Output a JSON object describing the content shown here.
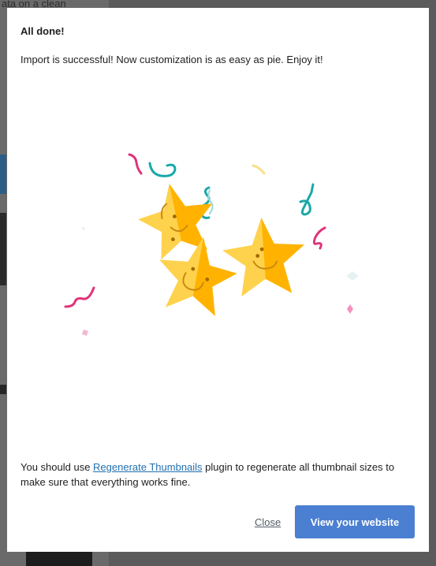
{
  "background": {
    "partial_text": "ata on a clean"
  },
  "dialog": {
    "title": "All done!",
    "message": "Import is successful! Now customization is as easy as pie. Enjoy it!",
    "note_prefix": "You should use ",
    "note_link": "Regenerate Thumbnails",
    "note_suffix": " plugin to regenerate all thumbnail sizes to make sure that everything works fine.",
    "close_label": "Close",
    "primary_label": "View your website"
  },
  "illustration": {
    "icons": [
      "star-face-icon",
      "confetti-icon"
    ]
  },
  "colors": {
    "primary": "#4a7fd2",
    "link": "#2271b1",
    "star_light": "#ffd24d",
    "star_dark": "#ffb300",
    "confetti_pink": "#e0337b",
    "confetti_teal": "#1aa8a8"
  }
}
